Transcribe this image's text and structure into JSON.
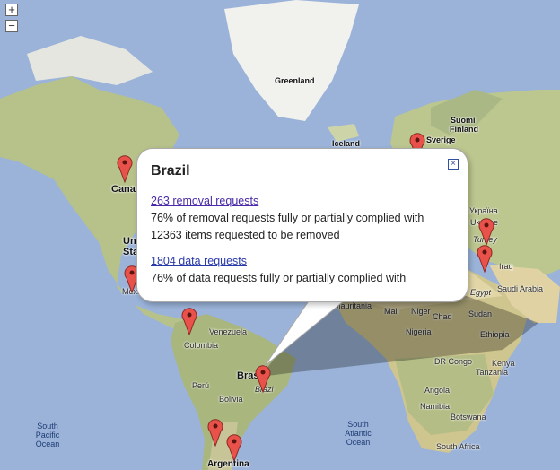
{
  "zoom": {
    "in_label": "+",
    "out_label": "−"
  },
  "labels": {
    "greenland": "Greenland",
    "iceland": "Iceland",
    "sverige": "Sverige",
    "suomi": "Suomi",
    "finland": "Finland",
    "canada": "Canada",
    "united": "Uni",
    "states": "Sta",
    "mexico": "Méxic",
    "venezuela": "Venezuela",
    "colombia": "Colombia",
    "peru": "Perú",
    "bolivia": "Bolivia",
    "brasil": "Brasi",
    "brazil": "Brazi",
    "argentina": "Argentina",
    "mauritania": "Mauritania",
    "mali": "Mali",
    "niger": "Niger",
    "chad": "Chad",
    "sudan": "Sudan",
    "nigeria": "Nigeria",
    "ethiopia": "Ethiopia",
    "drc": "DR Congo",
    "kenya": "Kenya",
    "tanzania": "Tanzania",
    "angola": "Angola",
    "namibia": "Namibia",
    "botswana": "Botswana",
    "southafrica": "South Africa",
    "iraq": "Iraq",
    "saudi": "Saudi Arabia",
    "egypt": "Egypt",
    "ukraine": "Україна",
    "ukraine2": "Ukraine",
    "turkey": "Turkey",
    "sp_ocean": "South Pacific Ocean",
    "sa_ocean": "South Atlantic Ocean"
  },
  "popup": {
    "title": "Brazil",
    "close_label": "×",
    "removal_link": "263 removal requests",
    "removal_complied": "76% of removal requests fully or partially complied with",
    "items_removed": "12363 items requested to be removed",
    "data_link": "1804 data requests",
    "data_complied": "76% of data requests fully or partially complied with"
  },
  "colors": {
    "ocean": "#9bb3d9",
    "land": "#c9cf9a",
    "pin": "#e8524a",
    "link": "#4a2aa8"
  }
}
